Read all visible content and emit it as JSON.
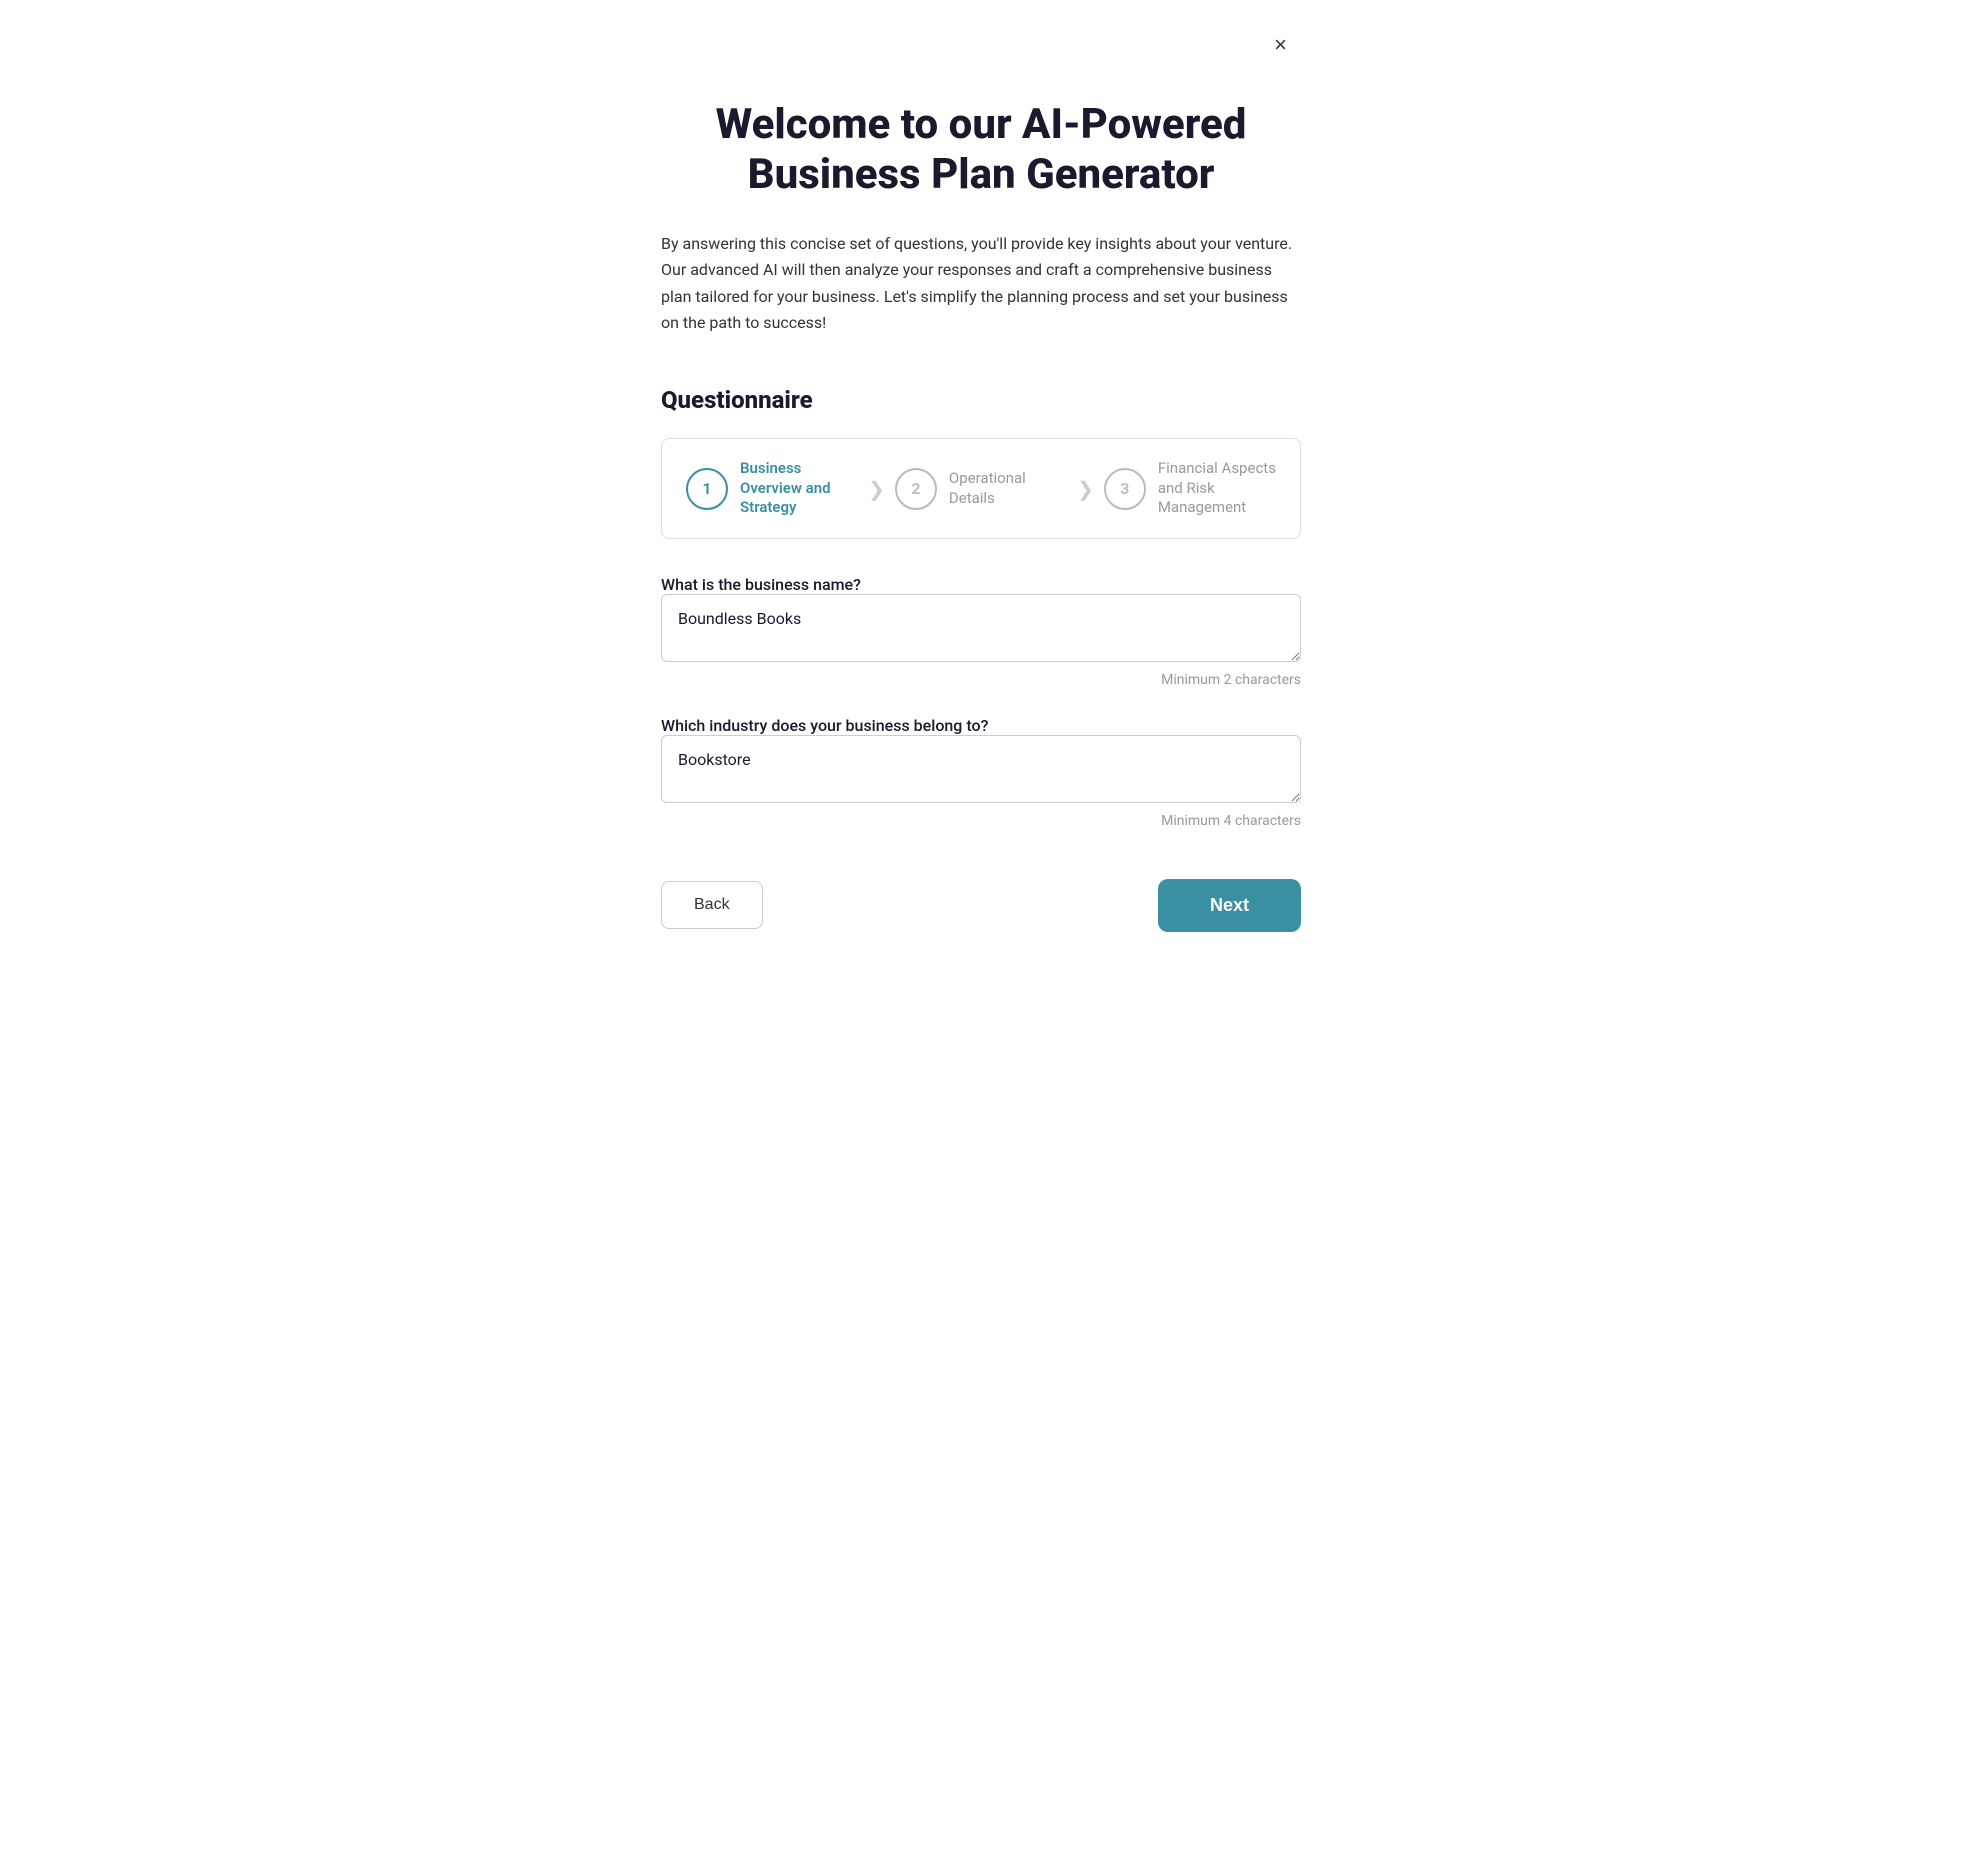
{
  "close_button": "×",
  "header": {
    "title": "Welcome to our AI-Powered Business Plan Generator"
  },
  "description": "By answering this concise set of questions, you'll provide key insights about your venture. Our advanced AI will then analyze your responses and craft a comprehensive business plan tailored for your business. Let's simplify the planning process and set your business on the path to success!",
  "questionnaire": {
    "title": "Questionnaire",
    "steps": [
      {
        "number": "1",
        "label": "Business Overview and Strategy",
        "state": "active"
      },
      {
        "number": "2",
        "label": "Operational Details",
        "state": "inactive"
      },
      {
        "number": "3",
        "label": "Financial Aspects and Risk Management",
        "state": "inactive"
      }
    ],
    "fields": [
      {
        "id": "business-name",
        "label": "What is the business name?",
        "value": "Boundless Books",
        "hint": "Minimum 2 characters"
      },
      {
        "id": "industry",
        "label": "Which industry does your business belong to?",
        "value": "Bookstore",
        "hint": "Minimum 4 characters"
      }
    ]
  },
  "buttons": {
    "back": "Back",
    "next": "Next"
  }
}
